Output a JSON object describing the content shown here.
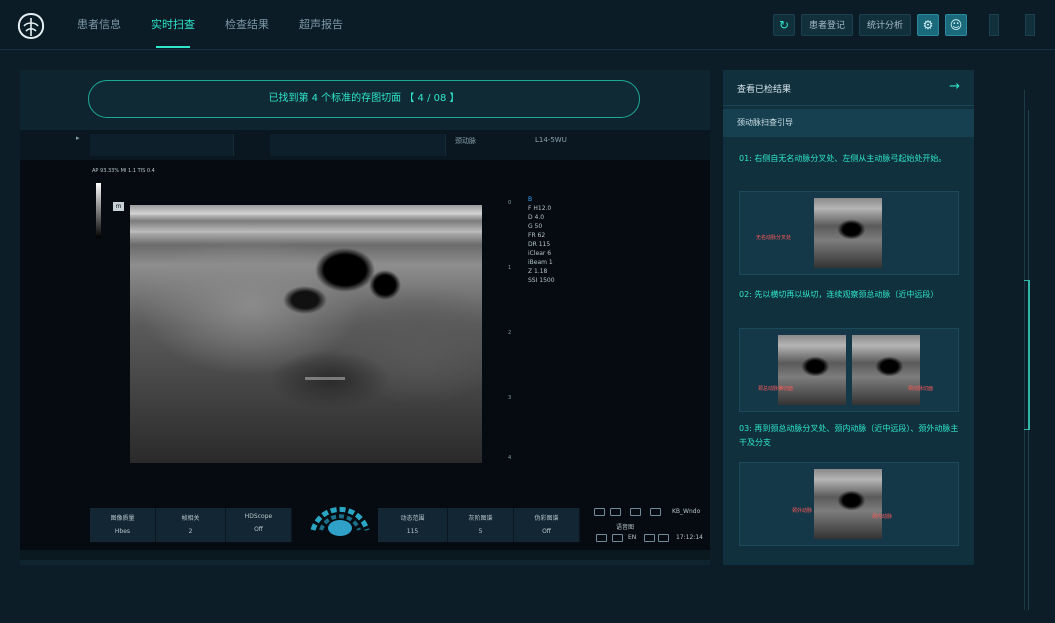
{
  "nav": {
    "items": [
      {
        "label": "患者信息"
      },
      {
        "label": "实时扫查"
      },
      {
        "label": "检查结果"
      },
      {
        "label": "超声报告"
      }
    ],
    "active_index": 1
  },
  "toolbar": {
    "refresh_icon": "refresh-icon",
    "register_label": "患者登记",
    "stats_label": "统计分析",
    "settings_icon": "settings-icon",
    "user_icon": "user-icon"
  },
  "status_pill": "已找到第 4 个标准的存图切面 【 4 / 08 】",
  "scan": {
    "header_label_1": "颈动脉",
    "probe": "L14-5WU",
    "ap_line": "AP 93.33% MI 1.1 TIS 0.4",
    "m_badge": "m",
    "params": [
      "B",
      "F H12.0",
      "D 4.0",
      "G 50",
      "FR 62",
      "DR 115",
      "iClear 6",
      "iBeam 1",
      "Z 1.18",
      "SSI 1500"
    ],
    "depth_ticks": [
      "0",
      "1",
      "2",
      "3",
      "4"
    ],
    "controls": [
      {
        "label": "图像质量",
        "value": "Hbes"
      },
      {
        "label": "帧相关",
        "value": "2"
      },
      {
        "label": "HDScope",
        "value": "Off"
      },
      {
        "label": "动态范围",
        "value": "115"
      },
      {
        "label": "灰阶图谱",
        "value": "5"
      },
      {
        "label": "伪彩图谱",
        "value": "Off"
      }
    ],
    "status_label_1": "KB_Wndo",
    "status_label_2": "语音图",
    "lang": "EN",
    "time": "17:12:14"
  },
  "right_panel": {
    "header_title": "查看已检结果",
    "header_arrow": "→",
    "subheader": "颈动脉扫查引导",
    "steps": [
      {
        "text": "01: 右侧自无名动脉分叉处、左侧从主动脉弓起始处开始。",
        "notes": [
          "无名动脉分叉处"
        ]
      },
      {
        "text": "02: 先以横切再以纵切，连续观察颈总动脉（近中远段）",
        "notes": [
          "颈总动脉横切面",
          "颈动脉切面"
        ]
      },
      {
        "text": "03: 再到颈总动脉分叉处、颈内动脉（近中远段）、颈外动脉主干及分支",
        "notes": [
          "颈外动脉",
          "颈内动脉"
        ]
      }
    ]
  },
  "colors": {
    "accent": "#2fe6cb",
    "background": "#0c1d28",
    "panel": "#10303d"
  }
}
